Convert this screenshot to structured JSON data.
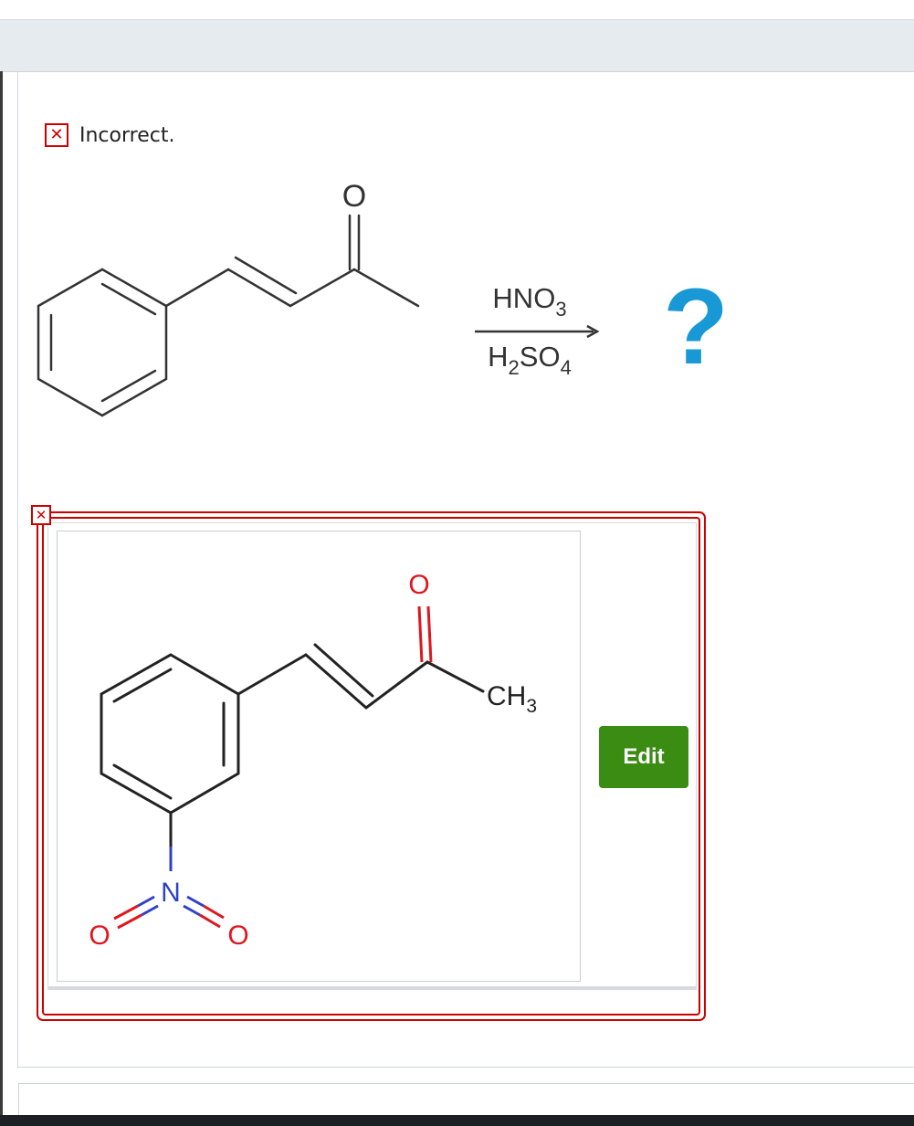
{
  "feedback": {
    "status_icon": "close-icon",
    "status_text": "Incorrect."
  },
  "reaction": {
    "carbonyl_oxygen": "O",
    "reagent_top": {
      "main": "HNO",
      "sub": "3"
    },
    "reagent_bottom": {
      "h": "H",
      "h_sub": "2",
      "main": "SO",
      "sub": "4"
    },
    "product_placeholder": "?"
  },
  "answer": {
    "status_icon": "close-icon",
    "atoms": {
      "carbonyl_oxygen": "O",
      "methyl": {
        "main": "CH",
        "sub": "3"
      },
      "nitrogen": "N",
      "nitro_oxygen_left": "O",
      "nitro_oxygen_right": "O"
    },
    "edit_label": "Edit"
  },
  "colors": {
    "error_red": "#cc0000",
    "question_blue": "#1899d6",
    "oxygen_red": "#e0161f",
    "nitrogen_blue": "#3040c8",
    "edit_green": "#3a8c12"
  }
}
